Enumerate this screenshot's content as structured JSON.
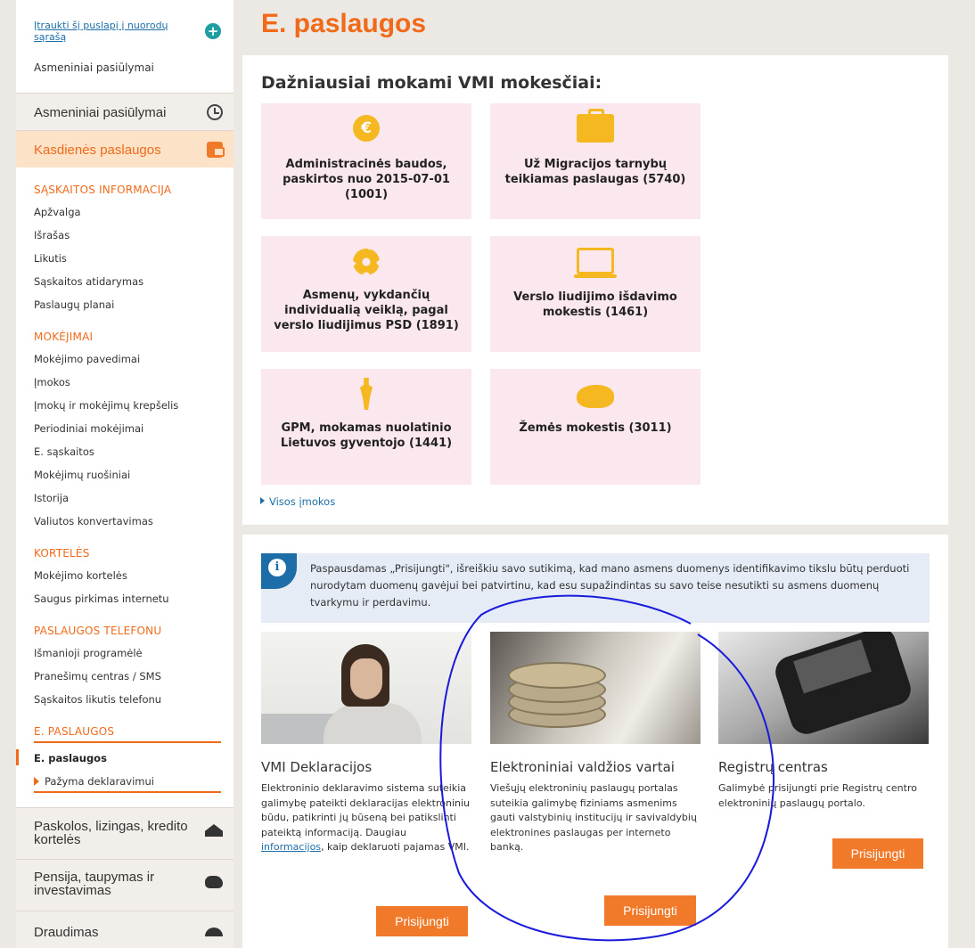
{
  "sidebar": {
    "add_link": "Įtraukti šį puslapį į nuorodų sąrašą",
    "personal_offers_text": "Asmeniniai pasiūlymai",
    "sections": {
      "personal_offers": "Asmeniniai pasiūlymai",
      "daily_services": "Kasdienės paslaugos"
    },
    "groups": {
      "account_info": {
        "title": "SĄSKAITOS INFORMACIJA",
        "items": [
          "Apžvalga",
          "Išrašas",
          "Likutis",
          "Sąskaitos atidarymas",
          "Paslaugų planai"
        ]
      },
      "payments": {
        "title": "MOKĖJIMAI",
        "items": [
          "Mokėjimo pavedimai",
          "Įmokos",
          "Įmokų ir mokėjimų krepšelis",
          "Periodiniai mokėjimai",
          "E. sąskaitos",
          "Mokėjimų ruošiniai",
          "Istorija",
          "Valiutos konvertavimas"
        ]
      },
      "cards": {
        "title": "KORTELĖS",
        "items": [
          "Mokėjimo kortelės",
          "Saugus pirkimas internetu"
        ]
      },
      "phone_services": {
        "title": "PASLAUGOS TELEFONU",
        "items": [
          "Išmanioji programėlė",
          "Pranešimų centras / SMS",
          "Sąskaitos likutis telefonu"
        ]
      },
      "e_services": {
        "title": "E. PASLAUGOS",
        "active_item": "E. paslaugos",
        "sub_item": "Pažyma deklaravimui"
      }
    },
    "bottom_sections": [
      "Paskolos, lizingas, kredito kortelės",
      "Pensija, taupymas ir investavimas",
      "Draudimas"
    ]
  },
  "main": {
    "title": "E. paslaugos",
    "taxes": {
      "heading": "Dažniausiai mokami VMI mokesčiai:",
      "tiles": [
        {
          "icon": "euro-icon",
          "text": "Administracinės baudos, paskirtos nuo 2015-07-01 (1001)"
        },
        {
          "icon": "briefcase-icon",
          "text": "Už Migracijos tarnybų teikiamas paslaugas (5740)"
        },
        {
          "icon": "gear-icon",
          "text": "Asmenų, vykdančių individualią veiklą, pagal verslo liudijimus PSD (1891)"
        },
        {
          "icon": "laptop-icon",
          "text": "Verslo liudijimo išdavimo mokestis (1461)"
        },
        {
          "icon": "person-icon",
          "text": "GPM, mokamas nuolatinio Lietuvos gyventojo (1441)"
        },
        {
          "icon": "piggy-bank-icon",
          "text": "Žemės mokestis (3011)"
        }
      ],
      "all_link": "Visos įmokos"
    },
    "consent_text": "Paspausdamas „Prisijungti\", išreiškiu savo sutikimą, kad mano asmens duomenys identifikavimo tikslu būtų perduoti nurodytam duomenų gavėjui bei patvirtinu, kad esu supažindintas su savo teise nesutikti su asmens duomenų tvarkymu ir perdavimu.",
    "services": [
      {
        "title": "VMI Deklaracijos",
        "desc_before": "Elektroninio deklaravimo sistema suteikia galimybę pateikti deklaracijas elektroniniu būdu, patikrinti jų būseną bei patikslinti pateiktą informaciją. Daugiau ",
        "desc_link": "informacijos",
        "desc_after": ", kaip deklaruoti pajamas VMI.",
        "button": "Prisijungti"
      },
      {
        "title": "Elektroniniai valdžios vartai",
        "desc": "Viešųjų elektroninių paslaugų portalas suteikia galimybę fiziniams asmenims gauti valstybinių institucijų ir savivaldybių elektronines paslaugas per interneto banką.",
        "button": "Prisijungti"
      },
      {
        "title": "Registrų centras",
        "desc": "Galimybė prisijungti prie Registrų centro elektroninių paslaugų portalo.",
        "button": "Prisijungti"
      }
    ]
  },
  "colors": {
    "accent": "#f06a1a",
    "button": "#f07a2a",
    "link": "#1d6ea8",
    "tile_bg": "#fbe7ee",
    "icon_yellow": "#f5b820",
    "annotation": "#1a1adb"
  }
}
